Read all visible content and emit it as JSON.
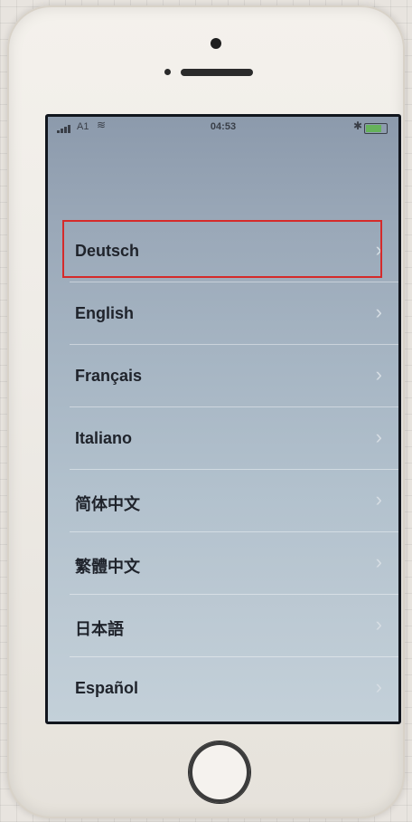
{
  "status_bar": {
    "carrier": "A1",
    "time": "04:53"
  },
  "battery": {
    "level_fraction": 0.72
  },
  "language_list": [
    {
      "label": "Deutsch"
    },
    {
      "label": "English"
    },
    {
      "label": "Français"
    },
    {
      "label": "Italiano"
    },
    {
      "label": "简体中文"
    },
    {
      "label": "繁體中文"
    },
    {
      "label": "日本語"
    },
    {
      "label": "Español"
    }
  ],
  "icons": {
    "chevron": "›",
    "wifi": "📶",
    "bluetooth": "✱"
  },
  "colors": {
    "highlight": "#d52a2a",
    "screen_tint": "#9fb0c0"
  }
}
